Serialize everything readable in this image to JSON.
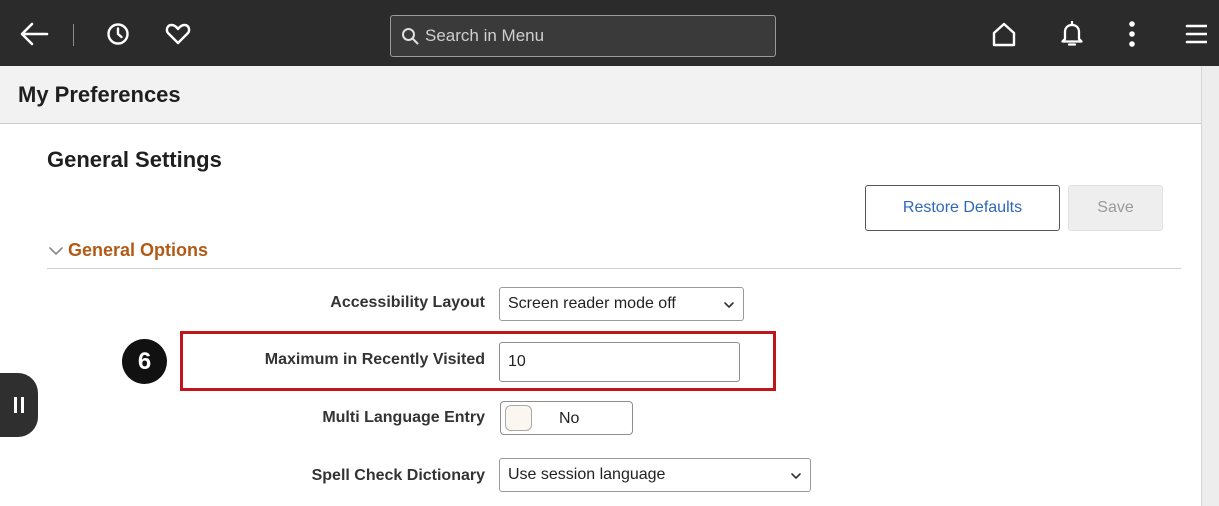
{
  "header": {
    "search_placeholder": "Search in Menu",
    "icons": [
      "back-arrow-icon",
      "history-clock-icon",
      "favorites-heart-icon",
      "search-icon",
      "home-icon",
      "notifications-bell-icon",
      "actions-menu-icon",
      "navbar-icon"
    ]
  },
  "page": {
    "title": "My Preferences"
  },
  "settings": {
    "section_title": "General Settings",
    "restore_label": "Restore Defaults",
    "save_label": "Save",
    "group_title": "General Options",
    "fields": {
      "accessibility": {
        "label": "Accessibility Layout",
        "value": "Screen reader mode off"
      },
      "recently_visited": {
        "label": "Maximum in Recently Visited",
        "value": "10"
      },
      "multi_language": {
        "label": "Multi Language Entry",
        "value": "No"
      },
      "spell_check": {
        "label": "Spell Check Dictionary",
        "value": "Use session language"
      }
    }
  },
  "annotation": {
    "step_number": "6",
    "highlight_color": "#c0151d"
  },
  "colors": {
    "banner": "#2b2b2b",
    "group_title": "#b15b17",
    "link_button": "#2f68b5"
  }
}
